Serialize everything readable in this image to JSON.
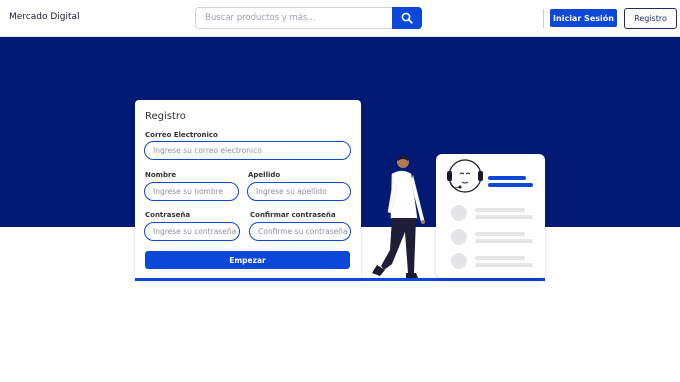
{
  "header": {
    "brand": "Mercado Digital",
    "search_placeholder": "Buscar productos y más...",
    "login_label": "Iniciar Sesión",
    "register_label": "Registro"
  },
  "form": {
    "title": "Registro",
    "email_label": "Correo Electronico",
    "email_placeholder": "Ingrese su correo electronico",
    "first_name_label": "Nombre",
    "first_name_placeholder": "Ingrese su nombre",
    "last_name_label": "Apellido",
    "last_name_placeholder": "Ingrese su apellido",
    "password_label": "Contraseña",
    "password_placeholder": "Ingrese su contraseña",
    "confirm_label": "Confirmar contraseña",
    "confirm_placeholder": "Confirme su contraseña",
    "submit_label": "Empezar"
  },
  "colors": {
    "accent": "#0b47d9",
    "hero_bg": "#021a73"
  },
  "icons": {
    "search": "search-icon"
  }
}
